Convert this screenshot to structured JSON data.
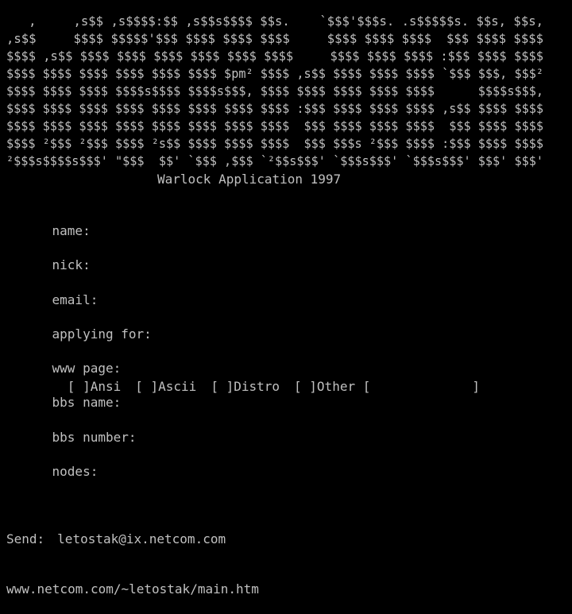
{
  "logo": {
    "lines": [
      "   ,     ,s$$ ,s$$$$:$$ ,s$$s$$$$ $$s.    `$$$'$$$s. .s$$$$$s. $$s, $$s,",
      ",s$$     $$$$ $$$$$'$$$ $$$$ $$$$ $$$$     $$$$ $$$$ $$$$  $$$ $$$$ $$$$",
      "$$$$ ,s$$ $$$$ $$$$ $$$$ $$$$ $$$$ $$$$     $$$$ $$$$ $$$$ :$$$ $$$$ $$$$",
      "$$$$ $$$$ $$$$ $$$$ $$$$ $$$$ $pm² $$$$ ,s$$ $$$$ $$$$ $$$$ `$$$ $$$, $$$²",
      "$$$$ $$$$ $$$$ $$$$s$$$$ $$$$s$$$, $$$$ $$$$ $$$$ $$$$ $$$$      $$$$s$$$,",
      "$$$$ $$$$ $$$$ $$$$ $$$$ $$$$ $$$$ $$$$ :$$$ $$$$ $$$$ $$$$ ,s$$ $$$$ $$$$",
      "$$$$ $$$$ $$$$ $$$$ $$$$ $$$$ $$$$ $$$$  $$$ $$$$ $$$$ $$$$  $$$ $$$$ $$$$",
      "$$$$ ²$$$ ²$$$ $$$$ ²s$$ $$$$ $$$$ $$$$  $$$ $$$s ²$$$ $$$$ :$$$ $$$$ $$$$",
      "²$$$s$$$$s$$$' \"$$$  $$' `$$$ ,$$$ `²$$s$$$' `$$$s$$$' `$$$s$$$' $$$' $$$'"
    ]
  },
  "subtitle": "Warlock Application 1997",
  "form": {
    "name_label": "name:",
    "nick_label": "nick:",
    "email_label": "email:",
    "applying_label": "applying for:",
    "options": [
      "Ansi",
      "Ascii",
      "Distro",
      "Other"
    ],
    "bracket_empty": "[ ]",
    "other_open": "[",
    "other_close": "]",
    "www_label": "www page:",
    "bbs_name_label": "bbs name:",
    "bbs_number_label": "bbs number:",
    "nodes_label": "nodes:"
  },
  "footer": {
    "send_label": "Send:",
    "email": "letostak@ix.netcom.com",
    "url": "www.netcom.com/~letostak/main.htm"
  }
}
